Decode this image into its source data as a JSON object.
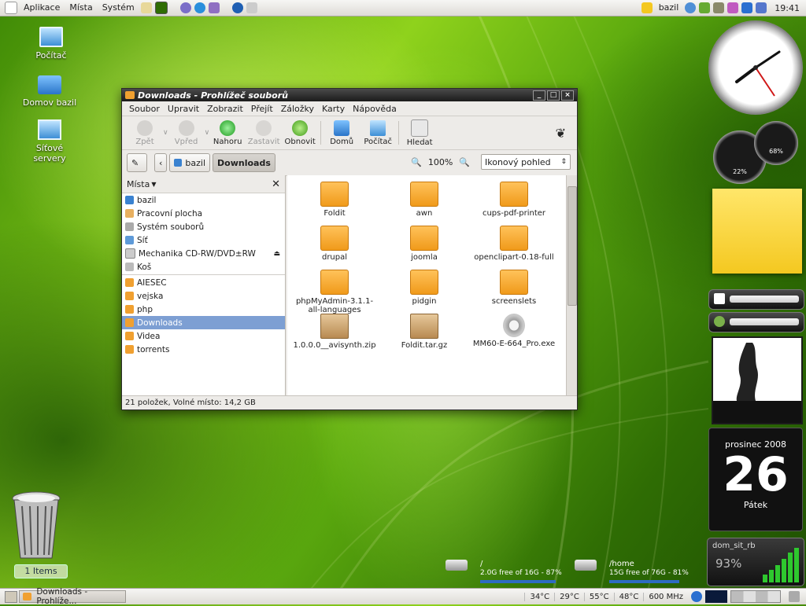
{
  "top_panel": {
    "menus": [
      "Aplikace",
      "Místa",
      "Systém"
    ],
    "user": "bazil",
    "time": "19:41"
  },
  "desktop_icons": [
    {
      "label": "Počítač"
    },
    {
      "label": "Domov bazil"
    },
    {
      "label": "Síťové servery"
    }
  ],
  "window": {
    "title": "Downloads - Prohlížeč souborů",
    "menu": [
      "Soubor",
      "Upravit",
      "Zobrazit",
      "Přejít",
      "Záložky",
      "Karty",
      "Nápověda"
    ],
    "toolbar": {
      "back": "Zpět",
      "forward": "Vpřed",
      "up": "Nahoru",
      "stop": "Zastavit",
      "reload": "Obnovit",
      "home": "Domů",
      "computer": "Počítač",
      "search": "Hledat"
    },
    "location": {
      "crumbs": [
        "bazil",
        "Downloads"
      ],
      "zoom": "100%",
      "view": "Ikonový pohled"
    },
    "sidebar": {
      "header": "Místa",
      "places": [
        "bazil",
        "Pracovní plocha",
        "Systém souborů",
        "Síť",
        "Mechanika CD-RW/DVD±RW",
        "Koš"
      ],
      "bookmarks": [
        "AIESEC",
        "vejska",
        "php",
        "Downloads",
        "Videa",
        "torrents"
      ],
      "selected": "Downloads"
    },
    "files": [
      {
        "name": "Foldit",
        "type": "folder"
      },
      {
        "name": "awn",
        "type": "folder"
      },
      {
        "name": "cups-pdf-printer",
        "type": "folder"
      },
      {
        "name": "drupal",
        "type": "folder"
      },
      {
        "name": "joomla",
        "type": "folder"
      },
      {
        "name": "openclipart-0.18-full",
        "type": "folder"
      },
      {
        "name": "phpMyAdmin-3.1.1-all-languages",
        "type": "folder"
      },
      {
        "name": "pidgin",
        "type": "folder"
      },
      {
        "name": "screenslets",
        "type": "folder"
      },
      {
        "name": "1.0.0.0__avisynth.zip",
        "type": "archive"
      },
      {
        "name": "Foldit.tar.gz",
        "type": "archive"
      },
      {
        "name": "MM60-E-664_Pro.exe",
        "type": "exe"
      }
    ],
    "status": "21 položek, Volné místo: 14,2 GB"
  },
  "widgets": {
    "gauge_left": "22%",
    "gauge_right": "68%",
    "calendar_month": "prosinec 2008",
    "calendar_day": "26",
    "calendar_weekday": "Pátek",
    "net_name": "dom_sit_rb",
    "net_signal": "93%",
    "drives": [
      {
        "mount": "/",
        "usage": "2.0G free of 16G - 87%",
        "fill_fraction": 0.87
      },
      {
        "mount": "/home",
        "usage": "15G free of 76G - 81%",
        "fill_fraction": 0.81
      }
    ]
  },
  "trash": {
    "label": "1 Items"
  },
  "bottom_panel": {
    "task": "Downloads - Prohlíže...",
    "temps": [
      "34°C",
      "29°C",
      "55°C",
      "48°C",
      "600 MHz"
    ]
  }
}
